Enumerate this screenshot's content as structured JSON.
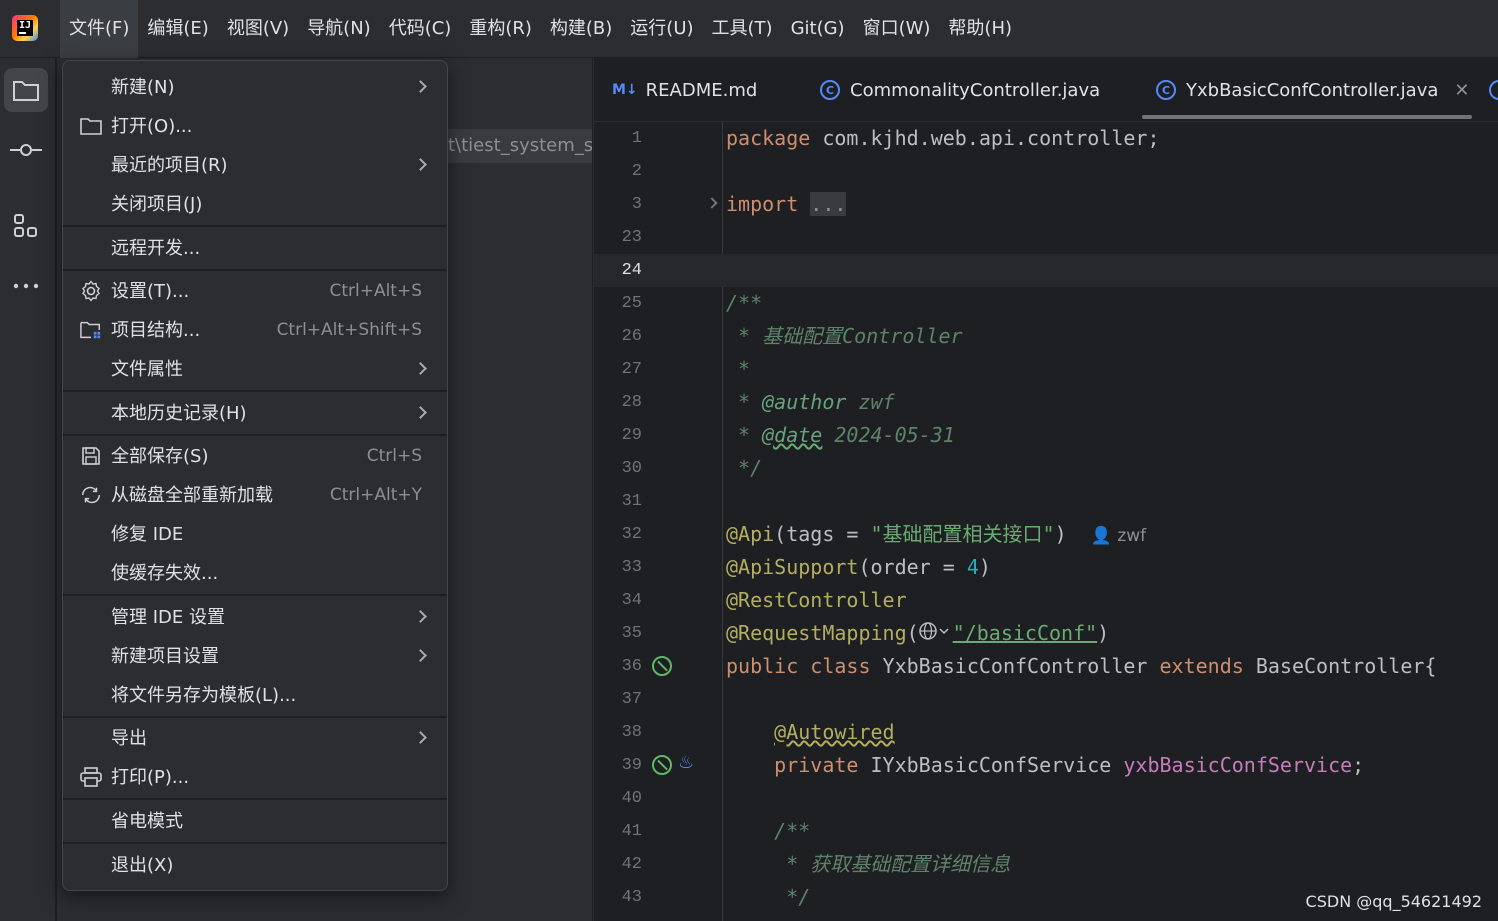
{
  "menubar": {
    "items": [
      "文件(F)",
      "编辑(E)",
      "视图(V)",
      "导航(N)",
      "代码(C)",
      "重构(R)",
      "构建(B)",
      "运行(U)",
      "工具(T)",
      "Git(G)",
      "窗口(W)",
      "帮助(H)"
    ]
  },
  "project_panel": {
    "path_fragment": "t\\tiest_system_se"
  },
  "file_menu": {
    "new": {
      "label": "新建(N)"
    },
    "open": {
      "label": "打开(O)..."
    },
    "recent": {
      "label": "最近的项目(R)"
    },
    "close_project": {
      "label": "关闭项目(J)"
    },
    "remote_dev": {
      "label": "远程开发..."
    },
    "settings": {
      "label": "设置(T)...",
      "shortcut": "Ctrl+Alt+S"
    },
    "project_structure": {
      "label": "项目结构...",
      "shortcut": "Ctrl+Alt+Shift+S"
    },
    "file_properties": {
      "label": "文件属性"
    },
    "local_history": {
      "label": "本地历史记录(H)"
    },
    "save_all": {
      "label": "全部保存(S)",
      "shortcut": "Ctrl+S"
    },
    "reload_all": {
      "label": "从磁盘全部重新加载",
      "shortcut": "Ctrl+Alt+Y"
    },
    "repair_ide": {
      "label": "修复 IDE"
    },
    "invalidate_caches": {
      "label": "使缓存失效..."
    },
    "manage_ide_settings": {
      "label": "管理 IDE 设置"
    },
    "new_project_settings": {
      "label": "新建项目设置"
    },
    "save_as_template": {
      "label": "将文件另存为模板(L)..."
    },
    "export": {
      "label": "导出"
    },
    "print": {
      "label": "打印(P)..."
    },
    "power_save": {
      "label": "省电模式"
    },
    "exit": {
      "label": "退出(X)"
    }
  },
  "tabs": {
    "readme": {
      "badge": "M↓",
      "label": "README.md"
    },
    "commonality": {
      "label": "CommonalityController.java"
    },
    "current": {
      "label": "YxbBasicConfController.java"
    }
  },
  "editor": {
    "line_numbers": [
      "1",
      "2",
      "3",
      "23",
      "24",
      "25",
      "26",
      "27",
      "28",
      "29",
      "30",
      "31",
      "32",
      "33",
      "34",
      "35",
      "36",
      "37",
      "38",
      "39",
      "40",
      "41",
      "42",
      "43"
    ],
    "code": {
      "l1_kw": "package",
      "l1_rest": " com.kjhd.web.api.controller;",
      "l3_kw": "import",
      "l3_fold": "...",
      "l25": "/**",
      "l26": " * 基础配置Controller",
      "l27": " *",
      "l28_star": " * ",
      "l28_tag": "@author",
      "l28_val": " zwf",
      "l29_star": " * ",
      "l29_tag": "@date",
      "l29_val": " 2024-05-31",
      "l30": " */",
      "l32_ann": "@Api",
      "l32_mid": "(tags = ",
      "l32_str": "\"基础配置相关接口\"",
      "l32_end": ")",
      "l32_author": "zwf",
      "l33_ann": "@ApiSupport",
      "l33_mid": "(order = ",
      "l33_num": "4",
      "l33_end": ")",
      "l34_ann": "@RestController",
      "l35_ann": "@RequestMapping",
      "l35_open": "(",
      "l35_str": "\"/basicConf\"",
      "l35_end": ")",
      "l36_kw1": "public",
      "l36_kw2": "class",
      "l36_name": " YxbBasicConfController ",
      "l36_kw3": "extends",
      "l36_rest": " BaseController{",
      "l38_ann": "@Autowired",
      "l39_kw": "private",
      "l39_type": " IYxbBasicConfService ",
      "l39_field": "yxbBasicConfService",
      "l39_end": ";",
      "l41": "/**",
      "l42": " * 获取基础配置详细信息",
      "l43": " */"
    }
  },
  "watermark": "CSDN @qq_54621492",
  "colors": {
    "background": "#1e1f22",
    "panel": "#2b2d30",
    "keyword": "#cf8e6d",
    "annotation": "#b3ae60",
    "string": "#6aab73",
    "number": "#2aacb8",
    "field": "#c77dbb",
    "doc_comment": "#5f826b",
    "accent": "#548af7"
  }
}
